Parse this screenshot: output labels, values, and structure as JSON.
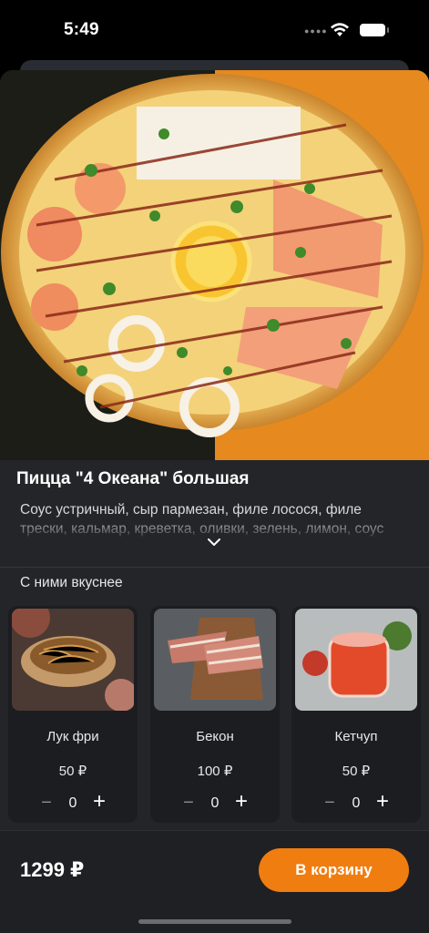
{
  "status": {
    "time": "5:49"
  },
  "product": {
    "title": "Пицца \"4 Океана\" большая",
    "description": "Соус устричный, сыр пармезан, филе лосося, филе трески, кальмар, креветка, оливки, зелень, лимон, соус унаги"
  },
  "addons": {
    "title": "С ними вкуснее",
    "items": [
      {
        "name": "Лук фри",
        "price": "50 ₽",
        "qty": "0",
        "minus": "−",
        "plus": "+"
      },
      {
        "name": "Бекон",
        "price": "100 ₽",
        "qty": "0",
        "minus": "−",
        "plus": "+"
      },
      {
        "name": "Кетчуп",
        "price": "50 ₽",
        "qty": "0",
        "minus": "−",
        "plus": "+"
      }
    ]
  },
  "footer": {
    "total": "1299 ₽",
    "cart_label": "В корзину"
  },
  "colors": {
    "accent": "#f07d10",
    "background": "#242529",
    "card": "#1c1d21"
  },
  "icons": [
    "wifi-icon",
    "battery-icon",
    "chevron-down-icon",
    "minus-icon",
    "plus-icon"
  ]
}
